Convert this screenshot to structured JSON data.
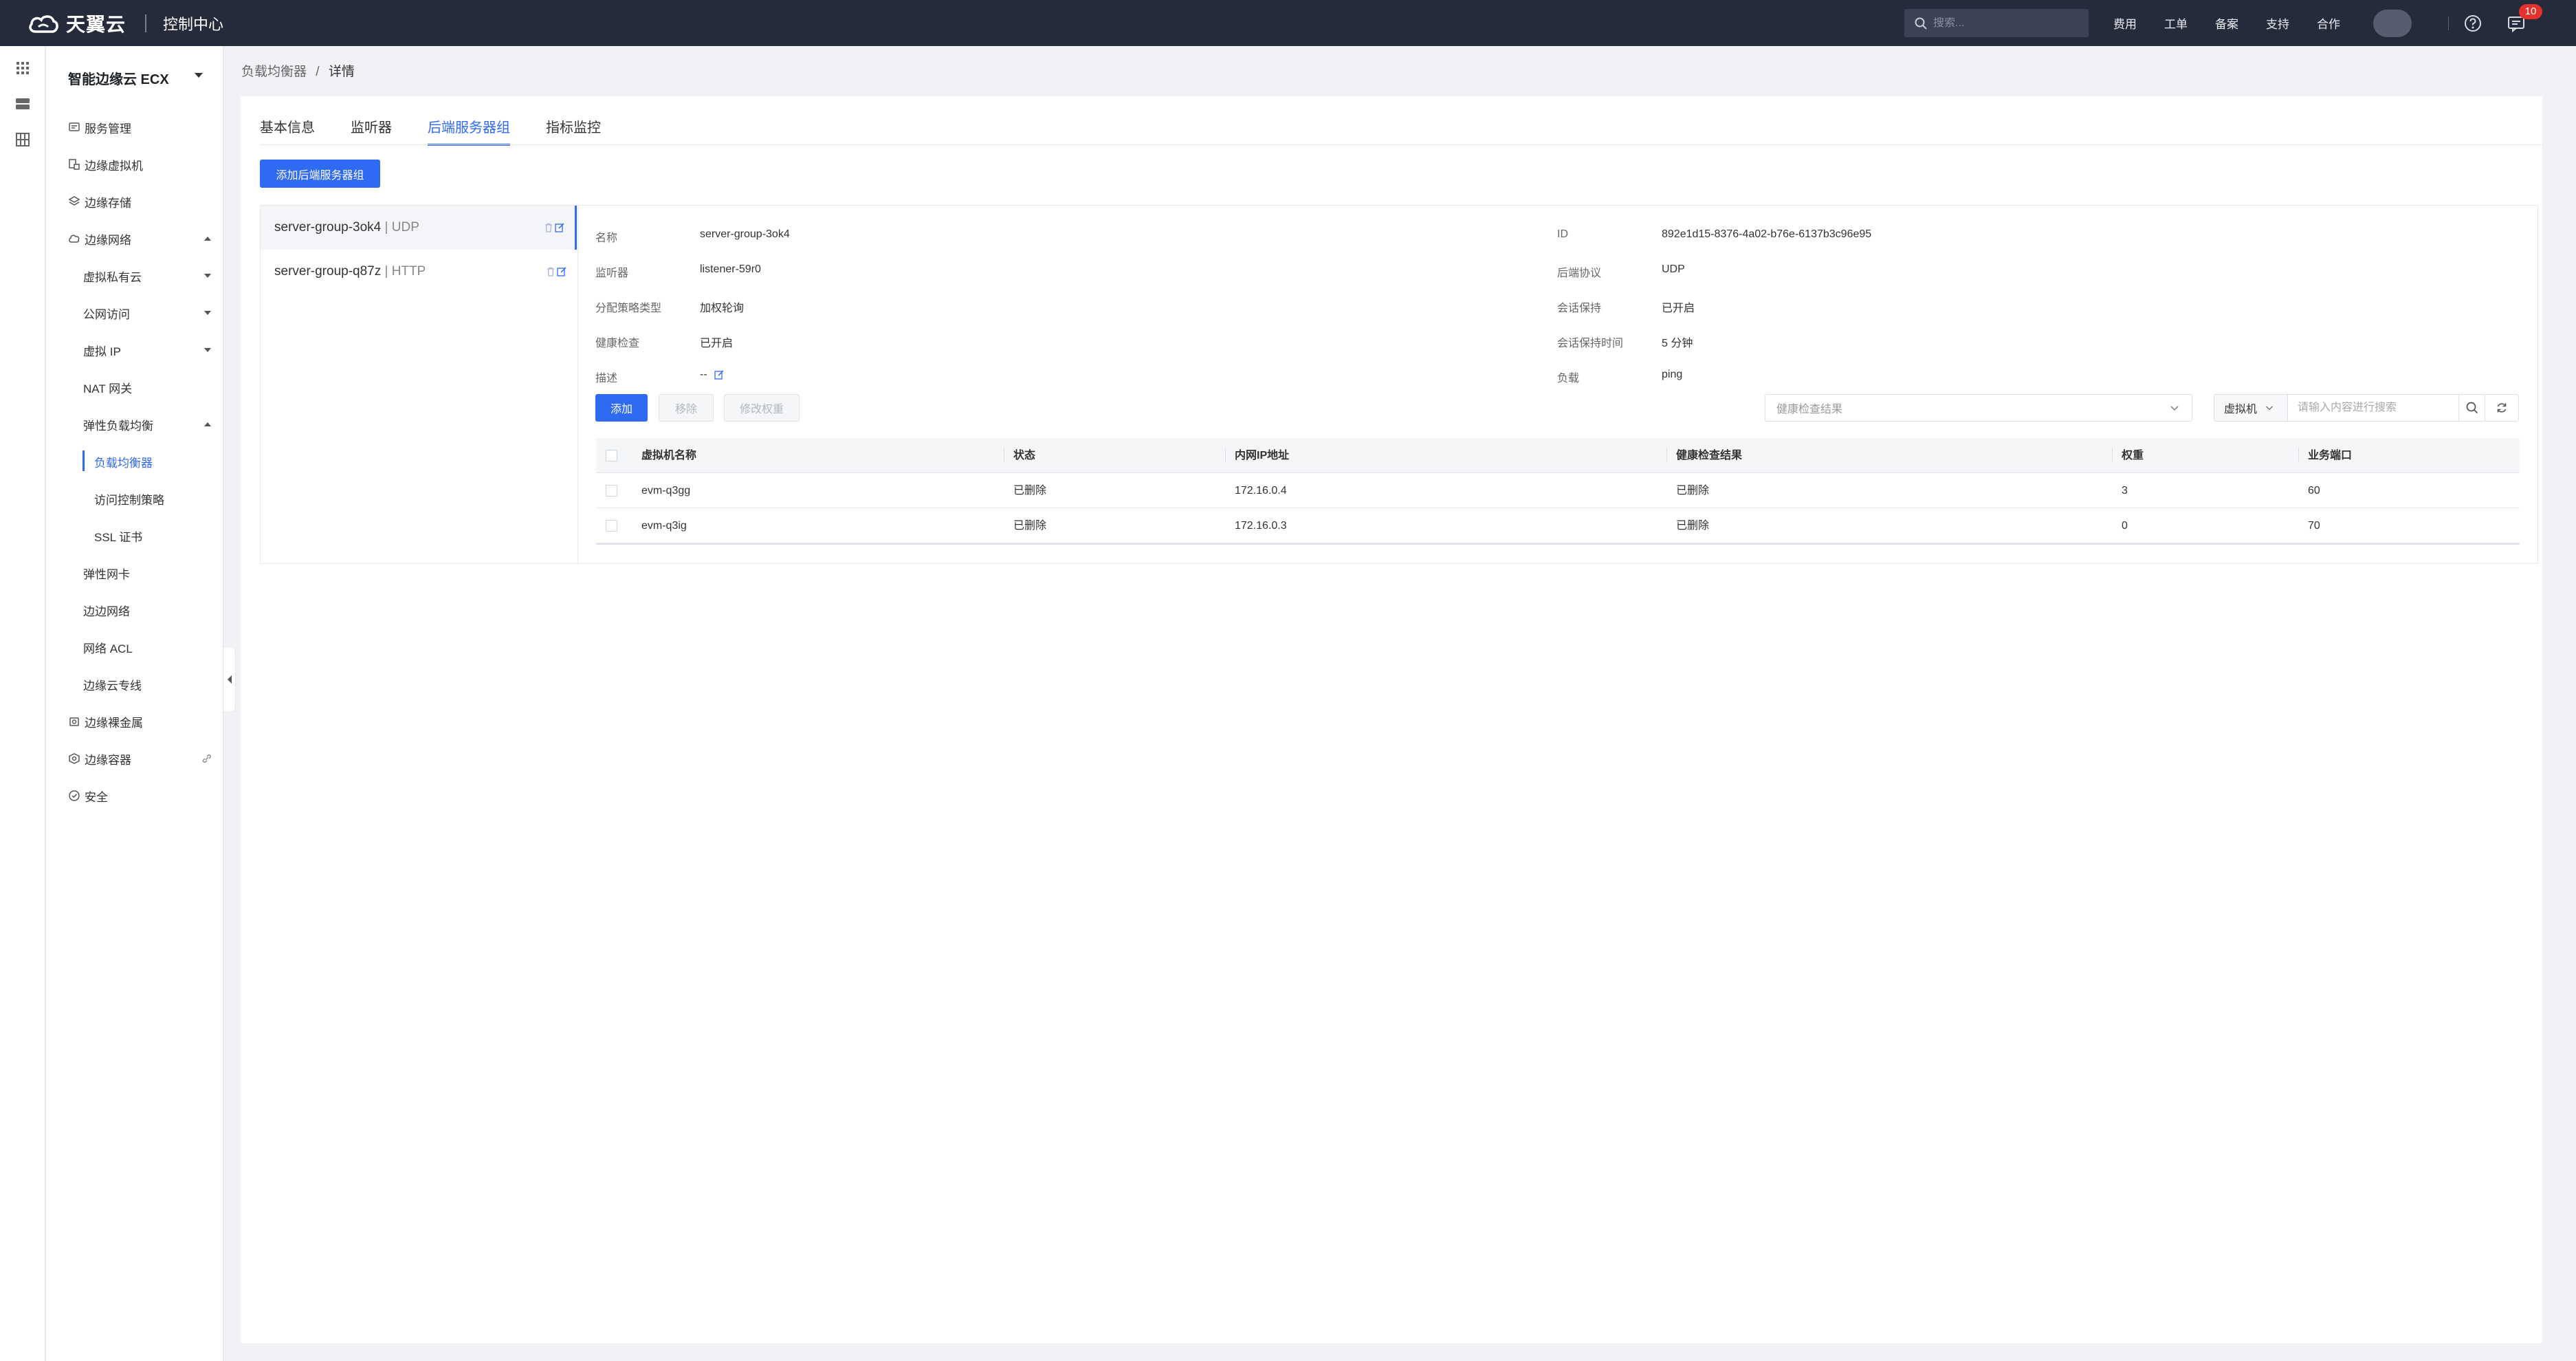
{
  "topbar": {
    "logo_text": "天翼云",
    "console_title": "控制中心",
    "search_placeholder": "搜索...",
    "links": [
      "费用",
      "工单",
      "备案",
      "支持",
      "合作"
    ],
    "message_count": "10"
  },
  "sidebar": {
    "product_title": "智能边缘云 ECX",
    "items": {
      "service_mgmt": "服务管理",
      "edge_vm": "边缘虚拟机",
      "edge_storage": "边缘存储",
      "edge_network": "边缘网络",
      "vpc": "虚拟私有云",
      "public_access": "公网访问",
      "virtual_ip": "虚拟 IP",
      "nat_gateway": "NAT 网关",
      "elb": "弹性负载均衡",
      "load_balancer": "负载均衡器",
      "access_control": "访问控制策略",
      "ssl_cert": "SSL 证书",
      "elastic_nic": "弹性网卡",
      "edge_to_edge": "边边网络",
      "network_acl": "网络 ACL",
      "edge_cloud_line": "边缘云专线",
      "bare_metal": "边缘裸金属",
      "container": "边缘容器",
      "security": "安全"
    }
  },
  "breadcrumb": {
    "parent": "负载均衡器",
    "separator": "/",
    "current": "详情"
  },
  "tabs": [
    "基本信息",
    "监听器",
    "后端服务器组",
    "指标监控"
  ],
  "add_group_button": "添加后端服务器组",
  "groups": [
    {
      "name": "server-group-3ok4",
      "protocol": "UDP"
    },
    {
      "name": "server-group-q87z",
      "protocol": "HTTP"
    }
  ],
  "detail": {
    "left": [
      {
        "key": "名称",
        "value": "server-group-3ok4"
      },
      {
        "key": "监听器",
        "value": "listener-59r0"
      },
      {
        "key": "分配策略类型",
        "value": "加权轮询"
      },
      {
        "key": "健康检查",
        "value": "已开启"
      },
      {
        "key": "描述",
        "value": "--"
      }
    ],
    "right": [
      {
        "key": "ID",
        "value": "892e1d15-8376-4a02-b76e-6137b3c96e95"
      },
      {
        "key": "后端协议",
        "value": "UDP"
      },
      {
        "key": "会话保持",
        "value": "已开启"
      },
      {
        "key": "会话保持时间",
        "value": "5 分钟"
      },
      {
        "key": "负载",
        "value": "ping"
      }
    ]
  },
  "actions": {
    "add": "添加",
    "remove": "移除",
    "edit_weight": "修改权重"
  },
  "filters": {
    "health_placeholder": "健康检查结果",
    "vm_select": "虚拟机",
    "search_placeholder": "请输入内容进行搜索"
  },
  "table": {
    "columns": [
      "虚拟机名称",
      "状态",
      "内网IP地址",
      "健康检查结果",
      "权重",
      "业务端口"
    ],
    "rows": [
      [
        "evm-q3gg",
        "已删除",
        "172.16.0.4",
        "已删除",
        "3",
        "60"
      ],
      [
        "evm-q3ig",
        "已删除",
        "172.16.0.3",
        "已删除",
        "0",
        "70"
      ]
    ]
  }
}
